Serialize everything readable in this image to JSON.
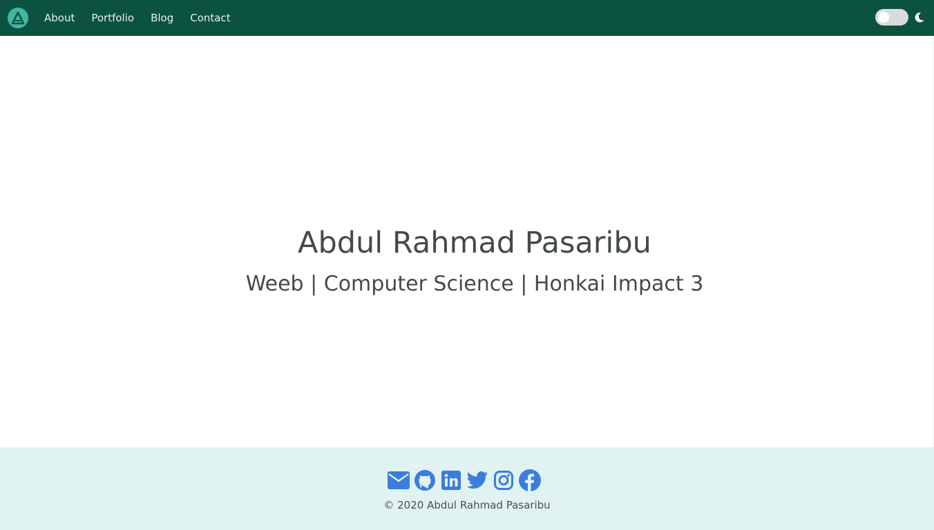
{
  "colors": {
    "navbar": "#0b5340",
    "logo": "#3fb8a3",
    "footer": "#e0f2f1",
    "social": "#3b7ddd",
    "text": "#444a4a"
  },
  "nav": {
    "logo_icon": "triangle-a-logo-icon",
    "links": [
      "About",
      "Portfolio",
      "Blog",
      "Contact"
    ],
    "theme_toggle_icon": "moon-icon"
  },
  "hero": {
    "title": "Abdul Rahmad Pasaribu",
    "subtitle": "Weeb | Computer Science | Honkai Impact 3"
  },
  "footer": {
    "social_icons": [
      "envelope-icon",
      "github-icon",
      "linkedin-icon",
      "twitter-icon",
      "instagram-icon",
      "facebook-icon"
    ],
    "copyright": "© 2020 Abdul Rahmad Pasaribu"
  }
}
